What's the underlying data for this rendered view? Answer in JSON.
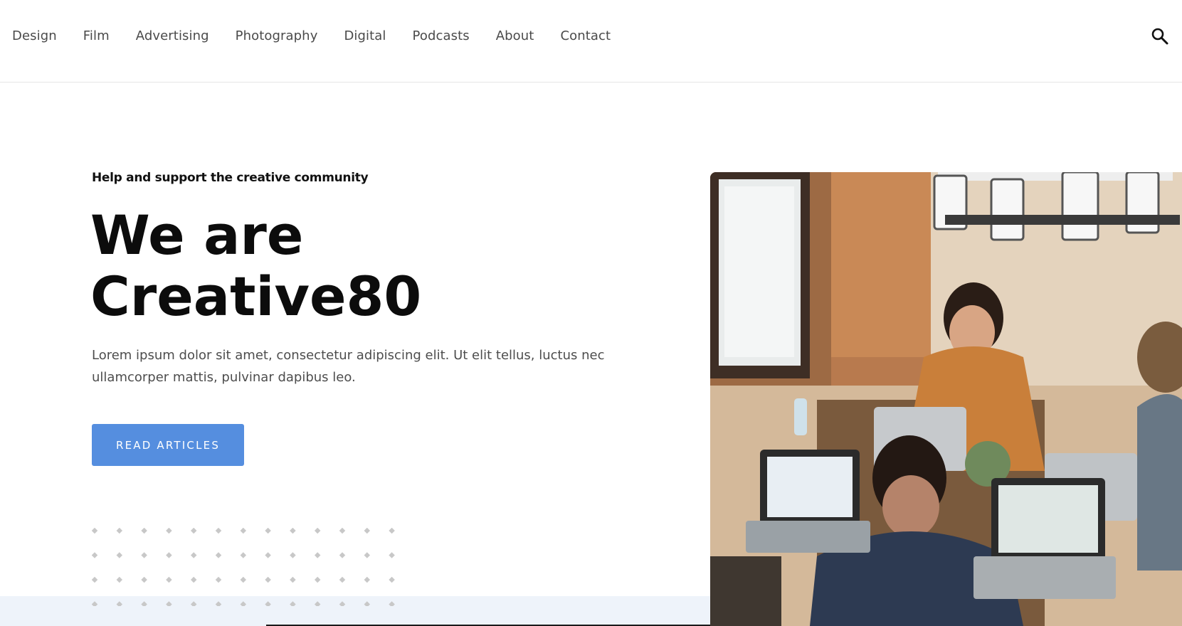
{
  "nav": {
    "items": [
      "Design",
      "Film",
      "Advertising",
      "Photography",
      "Digital",
      "Podcasts",
      "About",
      "Contact"
    ],
    "search_icon": "search-icon"
  },
  "hero": {
    "eyebrow": "Help and support the creative community",
    "headline_line1": "We are",
    "headline_line2": "Creative80",
    "lead": "Lorem ipsum dolor sit amet, consectetur adipiscing elit. Ut elit tellus, luctus nec ullamcorper mattis, pulvinar dapibus leo.",
    "cta_label": "READ ARTICLES"
  },
  "colors": {
    "accent": "#558edf",
    "text_dark": "#0c0c0c",
    "text_body": "#4d4d4d",
    "nav_text": "#4a4a4a",
    "band": "#eef3fa"
  }
}
